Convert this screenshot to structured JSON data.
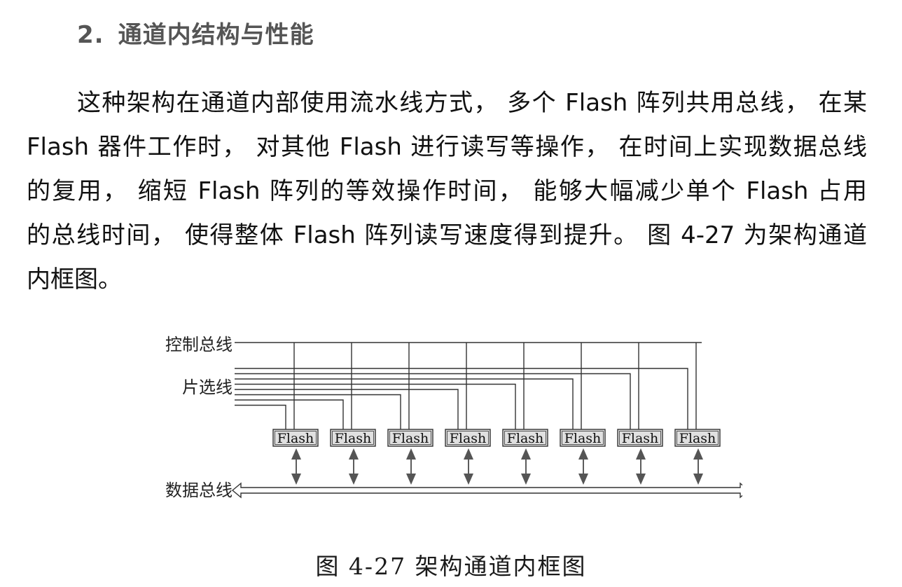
{
  "section": {
    "number": "2.",
    "title": "通道内结构与性能"
  },
  "paragraph": {
    "lines": [
      "这种架构在通道内部使用流水线方式， 多个 Flash 阵列共用总线， 在某",
      "Flash 器件工作时， 对其他 Flash 进行读写等操作， 在时间上实现数据总线",
      "的复用， 缩短 Flash 阵列的等效操作时间， 能够大幅减少单个 Flash 占用",
      "的总线时间， 使得整体 Flash 阵列读写速度得到提升。 图 4-27 为架构通道",
      "内框图。"
    ]
  },
  "figure": {
    "labels": {
      "control_bus": "控制总线",
      "chip_select": "片选线",
      "data_bus": "数据总线"
    },
    "chips": [
      "Flash",
      "Flash",
      "Flash",
      "Flash",
      "Flash",
      "Flash",
      "Flash",
      "Flash"
    ],
    "colors": {
      "line": "#333333",
      "chip_fill": "#e0e0e0",
      "arrow_fill": "#555555"
    }
  },
  "caption": "图 4-27 架构通道内框图"
}
